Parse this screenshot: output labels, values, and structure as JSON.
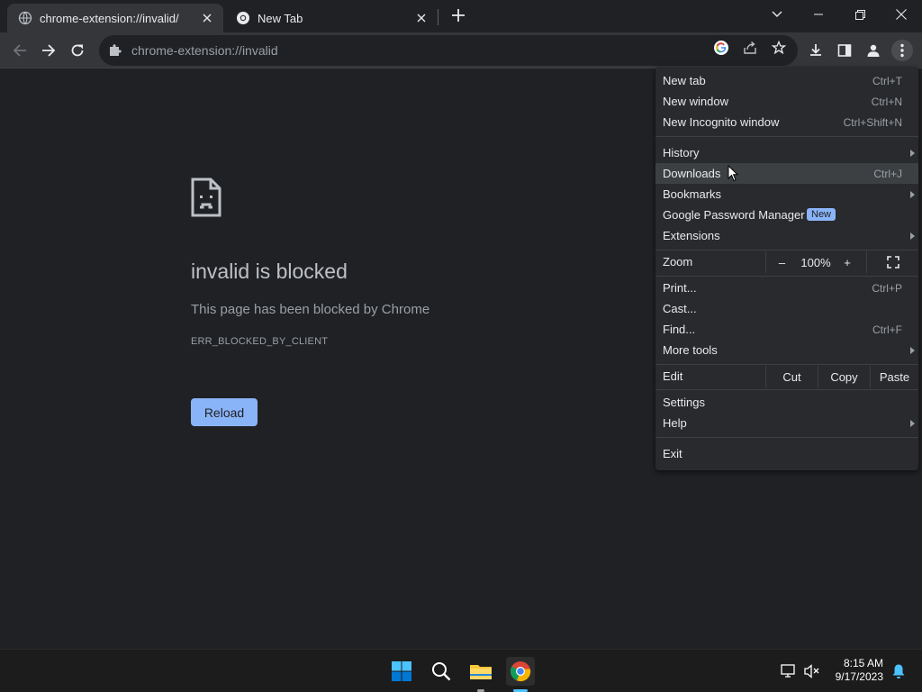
{
  "tabs": [
    {
      "title": "chrome-extension://invalid/",
      "active": true
    },
    {
      "title": "New Tab",
      "active": false
    }
  ],
  "address_bar": {
    "url": "chrome-extension://invalid"
  },
  "error_page": {
    "title": "invalid is blocked",
    "description": "This page has been blocked by Chrome",
    "code": "ERR_BLOCKED_BY_CLIENT",
    "reload_label": "Reload"
  },
  "menu": {
    "new_tab": {
      "label": "New tab",
      "shortcut": "Ctrl+T"
    },
    "new_window": {
      "label": "New window",
      "shortcut": "Ctrl+N"
    },
    "new_incognito": {
      "label": "New Incognito window",
      "shortcut": "Ctrl+Shift+N"
    },
    "history": {
      "label": "History"
    },
    "downloads": {
      "label": "Downloads",
      "shortcut": "Ctrl+J"
    },
    "bookmarks": {
      "label": "Bookmarks"
    },
    "password_manager": {
      "label": "Google Password Manager",
      "badge": "New"
    },
    "extensions": {
      "label": "Extensions"
    },
    "zoom": {
      "label": "Zoom",
      "minus": "–",
      "value": "100%",
      "plus": "+"
    },
    "print": {
      "label": "Print...",
      "shortcut": "Ctrl+P"
    },
    "cast": {
      "label": "Cast..."
    },
    "find": {
      "label": "Find...",
      "shortcut": "Ctrl+F"
    },
    "more_tools": {
      "label": "More tools"
    },
    "edit": {
      "label": "Edit",
      "cut": "Cut",
      "copy": "Copy",
      "paste": "Paste"
    },
    "settings": {
      "label": "Settings"
    },
    "help": {
      "label": "Help"
    },
    "exit": {
      "label": "Exit"
    }
  },
  "taskbar": {
    "time": "8:15 AM",
    "date": "9/17/2023"
  },
  "colors": {
    "accent": "#8ab4f8",
    "background": "#202124",
    "menu": "#292a2d"
  },
  "icons": [
    "globe-icon",
    "chrome-icon",
    "close-icon",
    "plus-icon",
    "back-icon",
    "forward-icon",
    "reload-icon",
    "puzzle-icon",
    "google-icon",
    "share-icon",
    "star-icon",
    "download-icon",
    "sidepanel-icon",
    "profile-icon",
    "kebab-menu-icon",
    "sad-page-icon",
    "windows-start-icon",
    "search-icon",
    "file-explorer-icon",
    "network-icon",
    "volume-muted-icon",
    "bell-icon"
  ]
}
